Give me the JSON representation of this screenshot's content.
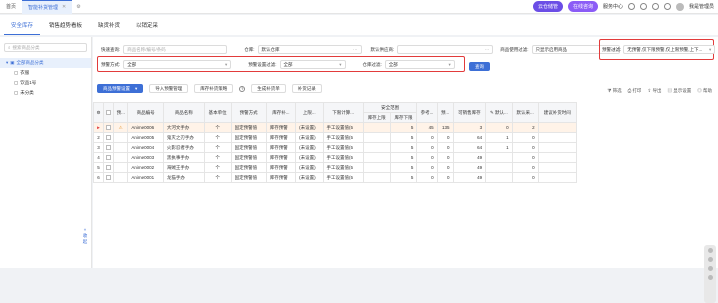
{
  "tabs": [
    {
      "label": "首页"
    },
    {
      "label": "智能补货管理",
      "active": true
    }
  ],
  "topbar": {
    "pill1": "云仓储管",
    "pill2": "在线咨询",
    "service": "服务中心",
    "user": "我是管理员"
  },
  "subtabs": [
    "安全库存",
    "销售趋势看板",
    "缺货补货",
    "以销定采"
  ],
  "tree": {
    "search_placeholder": "搜索商品分类",
    "items": [
      {
        "label": "全部商品分类",
        "selected": true
      },
      {
        "label": "衣服"
      },
      {
        "label": "饮品1号"
      },
      {
        "label": "未分类"
      }
    ],
    "fold": "收起"
  },
  "filters": {
    "quick_search_label": "快速查询:",
    "quick_search_placeholder": "商品名称/编号/条码",
    "warehouse_label": "仓库:",
    "warehouse_value": "默认仓库",
    "supplier_label": "默认供应商:",
    "product_status_label": "商品使用过滤:",
    "product_status_value": "只显示启用商品",
    "warning_filter_label": "预警过滤:",
    "warning_filter_value": "无预警,仅下限预警,仅上限预警,上下...",
    "warn_method_label": "预警方式:",
    "warn_method_value": "全部",
    "setting_label": "预警设置过滤:",
    "setting_value": "全部",
    "stock_label": "仓库过滤:",
    "stock_value": "全部",
    "query_button": "查询"
  },
  "actions": {
    "batch_set": "商品预警设置",
    "import": "导入预警管理",
    "stock_warn": "库存补货策略",
    "help": "?",
    "generate": "生成补货单",
    "record": "补货记录",
    "tools": [
      "筛选",
      "打印",
      "导出",
      "显示设置",
      "帮助"
    ]
  },
  "table": {
    "headers": [
      "",
      "",
      "预...",
      "商品编号",
      "商品名称",
      "基本单位",
      "预警方式",
      "库存补...",
      "上限...",
      "下限计算...",
      "库存上限",
      "库存下限",
      "参考...",
      "预...",
      "可销售库存",
      "默认...",
      "默认采...",
      "建议补货时间"
    ],
    "group_header": "安全范围",
    "rows": [
      {
        "no": "",
        "warn": "⚠",
        "code": "Anime0006",
        "name": "大河文手办",
        "unit": "个",
        "method": "固定预警值",
        "strategy": "库存预警",
        "upper": "(未设置)",
        "lower_calc": "手工设置值(5",
        "stock_upper": "",
        "stock_lower": "5",
        "ref": "45",
        "pre": "135",
        "sale": "3",
        "def": "0",
        "purchase": "2",
        "time": ""
      },
      {
        "no": "2",
        "warn": "",
        "code": "Anime0005",
        "name": "鬼灭之刃手办",
        "unit": "个",
        "method": "固定预警值",
        "strategy": "库存预警",
        "upper": "(未设置)",
        "lower_calc": "手工设置值(5",
        "stock_upper": "",
        "stock_lower": "5",
        "ref": "0",
        "pre": "0",
        "sale": "64",
        "def": "1",
        "purchase": "0",
        "time": ""
      },
      {
        "no": "3",
        "warn": "",
        "code": "Anime0004",
        "name": "火影忍者手办",
        "unit": "个",
        "method": "固定预警值",
        "strategy": "库存预警",
        "upper": "(未设置)",
        "lower_calc": "手工设置值(5",
        "stock_upper": "",
        "stock_lower": "5",
        "ref": "0",
        "pre": "0",
        "sale": "64",
        "def": "1",
        "purchase": "0",
        "time": ""
      },
      {
        "no": "4",
        "warn": "",
        "code": "Anime0003",
        "name": "黑执事手办",
        "unit": "个",
        "method": "固定预警值",
        "strategy": "库存预警",
        "upper": "(未设置)",
        "lower_calc": "手工设置值(5",
        "stock_upper": "",
        "stock_lower": "5",
        "ref": "0",
        "pre": "0",
        "sale": "49",
        "def": "",
        "purchase": "0",
        "time": ""
      },
      {
        "no": "5",
        "warn": "",
        "code": "Anime0002",
        "name": "海贼王手办",
        "unit": "个",
        "method": "固定预警值",
        "strategy": "库存预警",
        "upper": "(未设置)",
        "lower_calc": "手工设置值(5",
        "stock_upper": "",
        "stock_lower": "5",
        "ref": "0",
        "pre": "0",
        "sale": "49",
        "def": "",
        "purchase": "0",
        "time": ""
      },
      {
        "no": "6",
        "warn": "",
        "code": "Anime0001",
        "name": "龙猫手办",
        "unit": "个",
        "method": "固定预警值",
        "strategy": "库存预警",
        "upper": "(未设置)",
        "lower_calc": "手工设置值(5",
        "stock_upper": "",
        "stock_lower": "5",
        "ref": "0",
        "pre": "0",
        "sale": "49",
        "def": "",
        "purchase": "0",
        "time": ""
      }
    ]
  },
  "colors": {
    "accent": "#3d6fd6",
    "highlight": "#e23b3b"
  }
}
